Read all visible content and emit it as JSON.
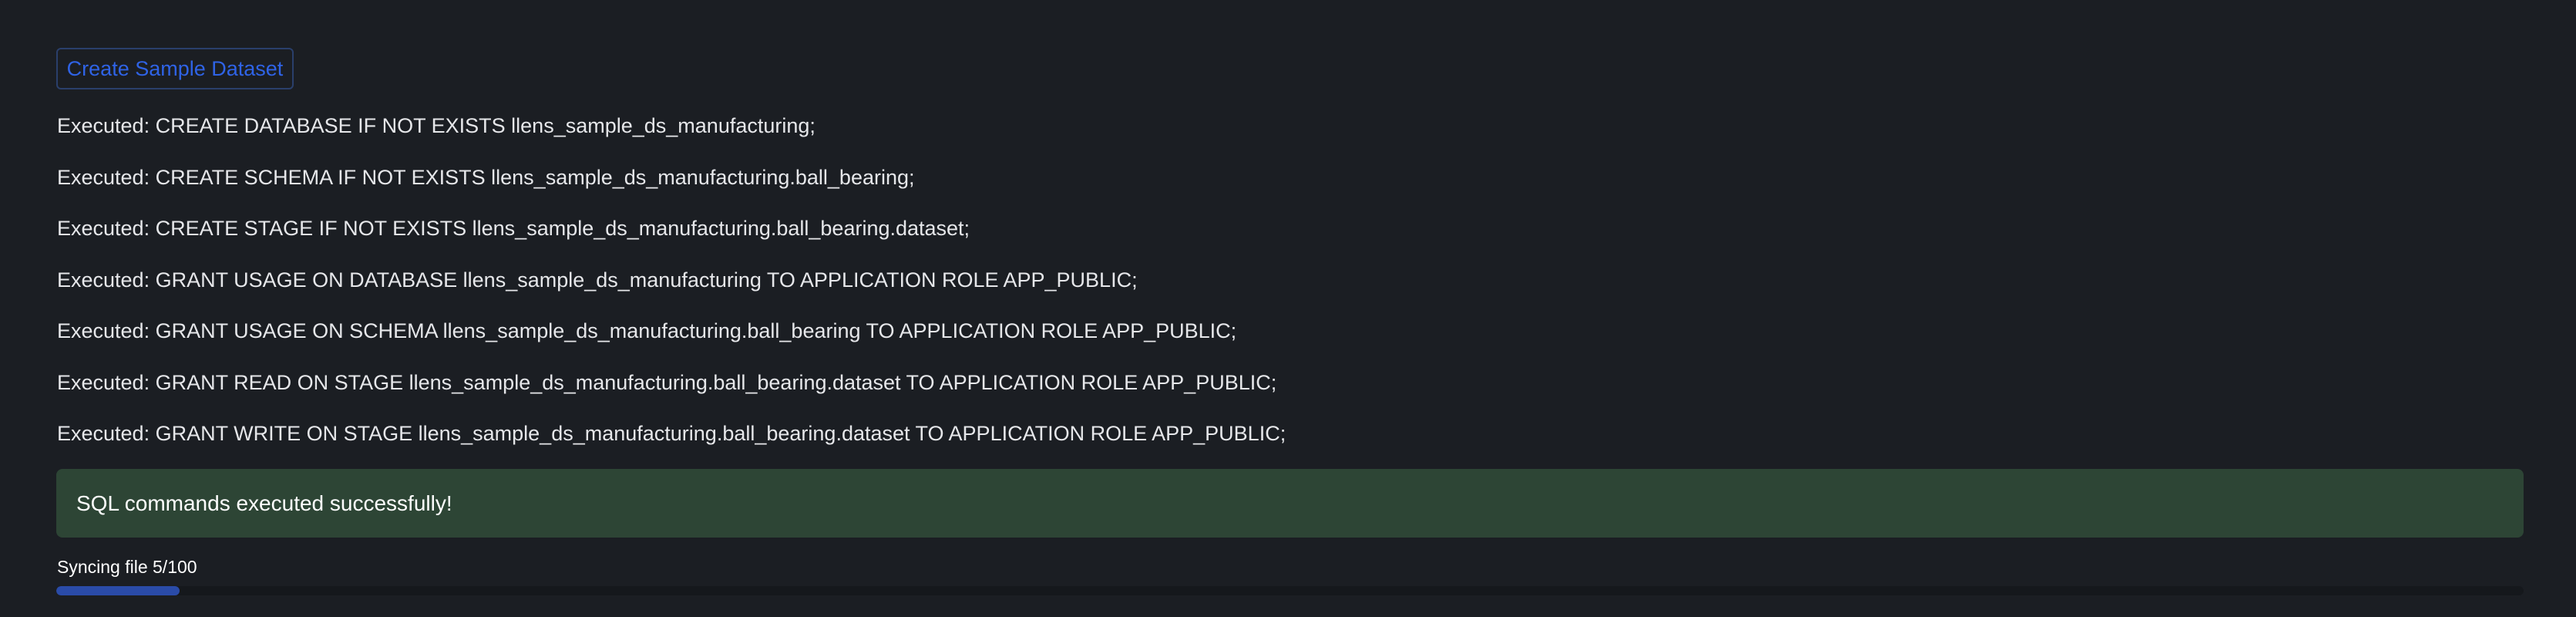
{
  "actions": {
    "create_label": "Create Sample Dataset"
  },
  "log": {
    "lines": [
      "Executed: CREATE DATABASE IF NOT EXISTS llens_sample_ds_manufacturing;",
      "Executed: CREATE SCHEMA IF NOT EXISTS llens_sample_ds_manufacturing.ball_bearing;",
      "Executed: CREATE STAGE IF NOT EXISTS llens_sample_ds_manufacturing.ball_bearing.dataset;",
      "Executed: GRANT USAGE ON DATABASE llens_sample_ds_manufacturing TO APPLICATION ROLE APP_PUBLIC;",
      "Executed: GRANT USAGE ON SCHEMA llens_sample_ds_manufacturing.ball_bearing TO APPLICATION ROLE APP_PUBLIC;",
      "Executed: GRANT READ ON STAGE llens_sample_ds_manufacturing.ball_bearing.dataset TO APPLICATION ROLE APP_PUBLIC;",
      "Executed: GRANT WRITE ON STAGE llens_sample_ds_manufacturing.ball_bearing.dataset TO APPLICATION ROLE APP_PUBLIC;"
    ]
  },
  "status": {
    "success_message": "SQL commands executed successfully!"
  },
  "progress": {
    "label": "Syncing file 5/100",
    "fraction": 0.05
  },
  "colors": {
    "background": "#1b1e23",
    "accent": "#2f63e6",
    "success_bg": "#2d4535",
    "progress_fill": "#2a4ba8"
  }
}
